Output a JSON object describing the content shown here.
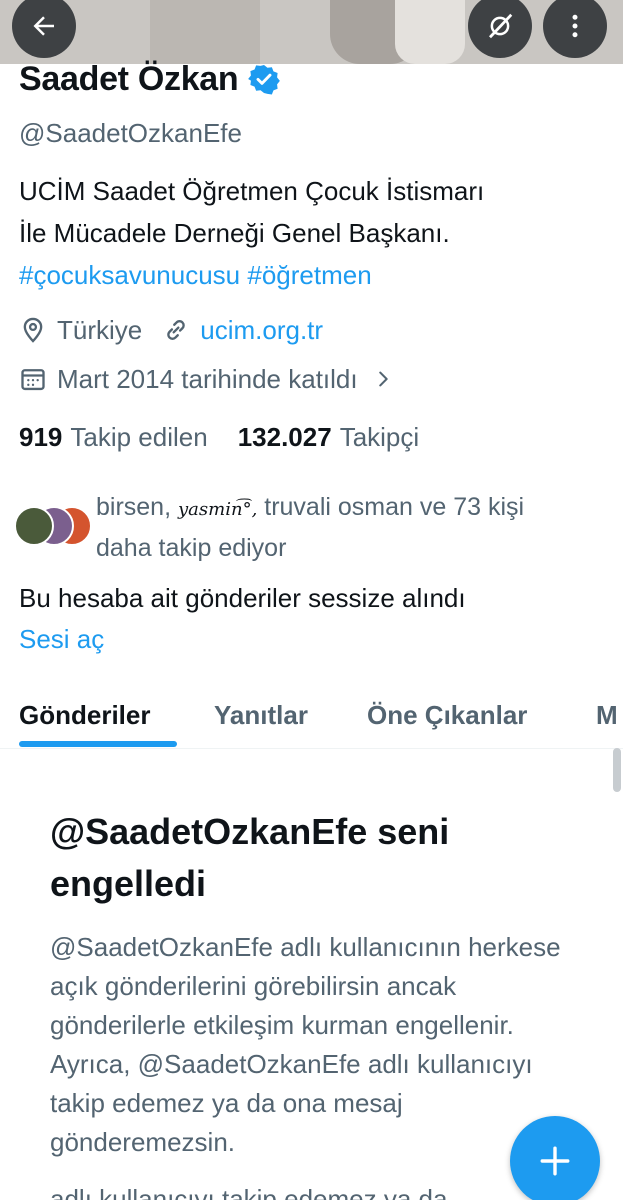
{
  "header": {
    "back_icon": "arrow-left-icon",
    "mute_icon": "muted-account-icon",
    "more_icon": "more-vertical-icon"
  },
  "profile": {
    "display_name": "Saadet Özkan",
    "verified": true,
    "handle": "@SaadetOzkanEfe",
    "bio_line1": "UCİM Saadet Öğretmen Çocuk İstismarı",
    "bio_line2": "İle Mücadele Derneği Genel Başkanı.",
    "hashtag1": "#çocuksavunucusu",
    "hashtag2": "#öğretmen",
    "location": "Türkiye",
    "website": "ucim.org.tr",
    "joined": "Mart 2014 tarihinde katıldı",
    "following_count": "919",
    "following_label": "Takip edilen",
    "followers_count": "132.027",
    "followers_label": "Takipçi"
  },
  "followers_you_know": {
    "name1": "birsen,",
    "name2": "yasmin",
    "name2_suffix": "͡°,",
    "rest_line1": "truvali osman ve 73 kişi",
    "line2": "daha takip ediyor"
  },
  "muted": {
    "note": "Bu hesaba ait gönderiler sessize alındı",
    "unmute_label": "Sesi aç"
  },
  "tabs": [
    {
      "label": "Gönderiler",
      "active": true
    },
    {
      "label": "Yanıtlar",
      "active": false
    },
    {
      "label": "Öne Çıkanlar",
      "active": false
    },
    {
      "label": "M",
      "active": false
    }
  ],
  "blocked": {
    "title_line1": "@SaadetOzkanEfe seni",
    "title_line2": "engelledi",
    "body": "@SaadetOzkanEfe adlı kullanıcının herkese açık gönderilerini görebilirsin ancak gönderilerle etkileşim kurman engellenir. Ayrıca, @SaadetOzkanEfe adlı kullanıcıyı takip edemez ya da ona mesaj gönderemezsin.",
    "cut_line": "adlı kullanıcıyı takip edemez ya da"
  },
  "fab": {
    "icon": "plus-icon"
  },
  "colors": {
    "accent": "#1d9bf0",
    "text_primary": "#0f1419",
    "text_secondary": "#536471"
  }
}
